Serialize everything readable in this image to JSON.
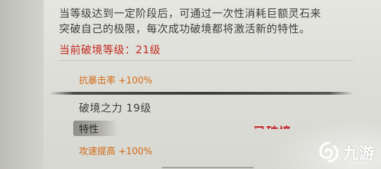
{
  "description_lines": [
    "当等级达到一定阶段后，可通过一次性消耗巨额灵石来",
    "突破自己的极限，每次成功破境都将激活新的特性。"
  ],
  "current_level_label": "当前破境等级：21级",
  "stat_1": "抗暴击率 +100%",
  "power": {
    "name_level": "破境之力 19级",
    "trait_tag": "特性",
    "stat": "攻速提高 +100%"
  },
  "partial_red_text": "已破境",
  "watermark": {
    "icon": "swirl-logo-icon",
    "text": "九游"
  },
  "colors": {
    "red": "#c22a1f",
    "orange": "#d26a14",
    "text": "#3d3d3d",
    "panel": "#e3e3de"
  }
}
